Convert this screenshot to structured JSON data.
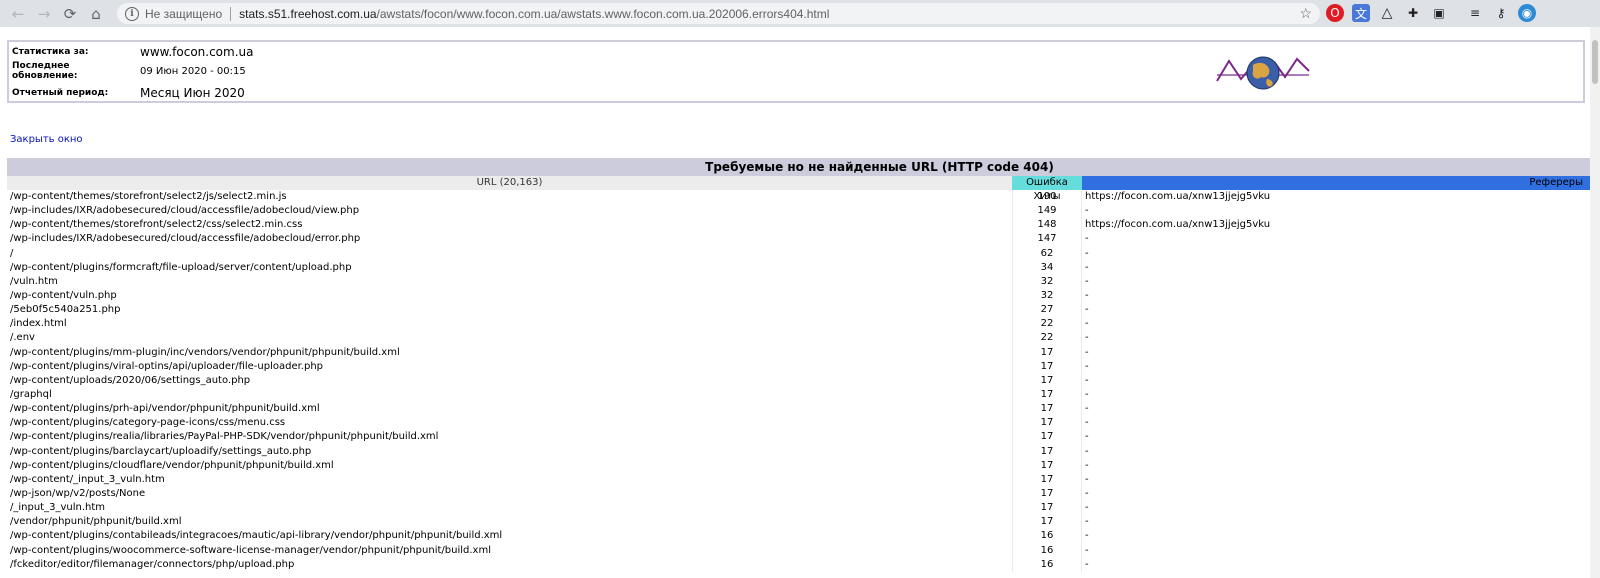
{
  "browser": {
    "security_label": "Не защищено",
    "url_host": "stats.s51.freehost.com.ua",
    "url_path": "/awstats/focon/www.focon.com.ua/awstats.www.focon.com.ua.202006.errors404.html",
    "nav": {
      "back": "←",
      "forward": "→",
      "reload": "⟳",
      "home": "⌂"
    },
    "star": "☆",
    "extensions": [
      "opera-icon",
      "translate-icon",
      "drive-icon",
      "puzzle-icon",
      "gamepad-icon",
      "playlist-icon",
      "key-icon",
      "profile-icon"
    ]
  },
  "info": {
    "stats_label": "Статистика за:",
    "stats_value": "www.focon.com.ua",
    "updated_label": "Последнее обновление:",
    "updated_value": "09 Июн 2020 - 00:15",
    "period_label": "Отчетный период:",
    "period_value": "Месяц Июн 2020"
  },
  "close_link": "Закрыть окно",
  "report": {
    "title": "Требуемые но не найденные URL (HTTP code 404)",
    "col_url": "URL (20,163)",
    "col_hits": "Ошибка Хиты",
    "col_ref": "Рефереры",
    "rows": [
      {
        "url": "/wp-content/themes/storefront/select2/js/select2.min.js",
        "hits": "190",
        "ref": "https://focon.com.ua/xnw13jjejg5vku"
      },
      {
        "url": "/wp-includes/IXR/adobesecured/cloud/accessfile/adobecloud/view.php",
        "hits": "149",
        "ref": "-"
      },
      {
        "url": "/wp-content/themes/storefront/select2/css/select2.min.css",
        "hits": "148",
        "ref": "https://focon.com.ua/xnw13jjejg5vku"
      },
      {
        "url": "/wp-includes/IXR/adobesecured/cloud/accessfile/adobecloud/error.php",
        "hits": "147",
        "ref": "-"
      },
      {
        "url": "/",
        "hits": "62",
        "ref": "-"
      },
      {
        "url": "/wp-content/plugins/formcraft/file-upload/server/content/upload.php",
        "hits": "34",
        "ref": "-"
      },
      {
        "url": "/vuln.htm",
        "hits": "32",
        "ref": "-"
      },
      {
        "url": "/wp-content/vuln.php",
        "hits": "32",
        "ref": "-"
      },
      {
        "url": "/5eb0f5c540a251.php",
        "hits": "27",
        "ref": "-"
      },
      {
        "url": "/index.html",
        "hits": "22",
        "ref": "-"
      },
      {
        "url": "/.env",
        "hits": "22",
        "ref": "-"
      },
      {
        "url": "/wp-content/plugins/mm-plugin/inc/vendors/vendor/phpunit/phpunit/build.xml",
        "hits": "17",
        "ref": "-"
      },
      {
        "url": "/wp-content/plugins/viral-optins/api/uploader/file-uploader.php",
        "hits": "17",
        "ref": "-"
      },
      {
        "url": "/wp-content/uploads/2020/06/settings_auto.php",
        "hits": "17",
        "ref": "-"
      },
      {
        "url": "/graphql",
        "hits": "17",
        "ref": "-"
      },
      {
        "url": "/wp-content/plugins/prh-api/vendor/phpunit/phpunit/build.xml",
        "hits": "17",
        "ref": "-"
      },
      {
        "url": "/wp-content/plugins/category-page-icons/css/menu.css",
        "hits": "17",
        "ref": "-"
      },
      {
        "url": "/wp-content/plugins/realia/libraries/PayPal-PHP-SDK/vendor/phpunit/phpunit/build.xml",
        "hits": "17",
        "ref": "-"
      },
      {
        "url": "/wp-content/plugins/barclaycart/uploadify/settings_auto.php",
        "hits": "17",
        "ref": "-"
      },
      {
        "url": "/wp-content/plugins/cloudflare/vendor/phpunit/phpunit/build.xml",
        "hits": "17",
        "ref": "-"
      },
      {
        "url": "/wp-content/_input_3_vuln.htm",
        "hits": "17",
        "ref": "-"
      },
      {
        "url": "/wp-json/wp/v2/posts/None",
        "hits": "17",
        "ref": "-"
      },
      {
        "url": "/_input_3_vuln.htm",
        "hits": "17",
        "ref": "-"
      },
      {
        "url": "/vendor/phpunit/phpunit/build.xml",
        "hits": "17",
        "ref": "-"
      },
      {
        "url": "/wp-content/plugins/contabileads/integracoes/mautic/api-library/vendor/phpunit/phpunit/build.xml",
        "hits": "16",
        "ref": "-"
      },
      {
        "url": "/wp-content/plugins/woocommerce-software-license-manager/vendor/phpunit/phpunit/build.xml",
        "hits": "16",
        "ref": "-"
      },
      {
        "url": "/fckeditor/editor/filemanager/connectors/php/upload.php",
        "hits": "16",
        "ref": "-"
      }
    ]
  }
}
